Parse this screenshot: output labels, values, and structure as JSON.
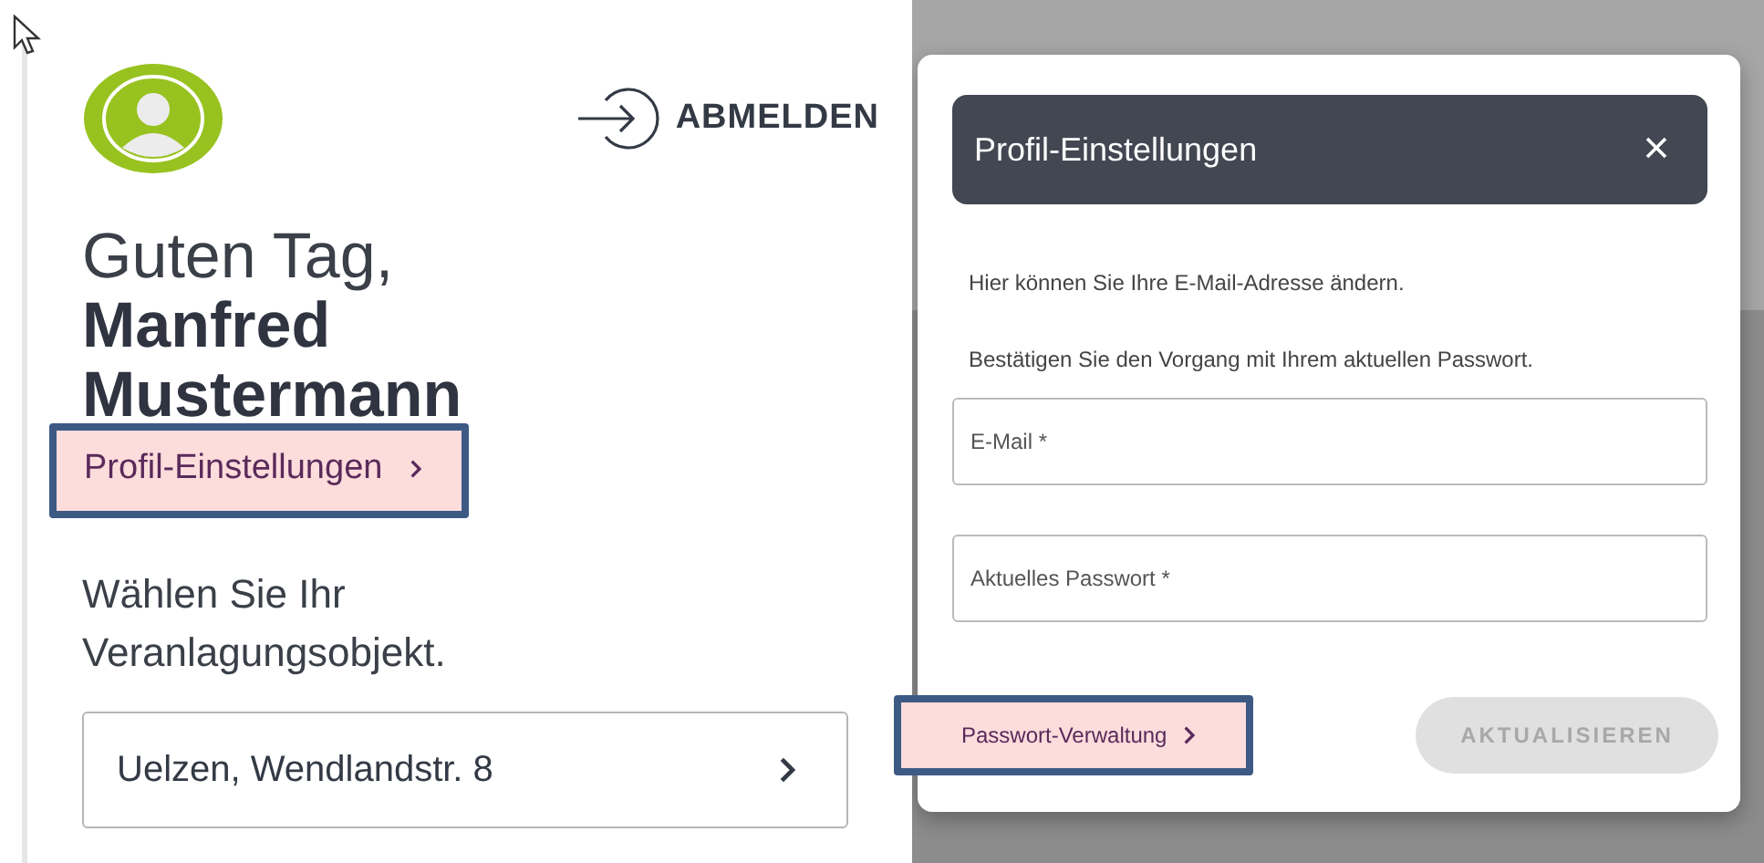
{
  "page": {
    "logout_label": "ABMELDEN",
    "greeting": "Guten Tag,",
    "name": "Manfred Mustermann",
    "profile_link": "Profil-Einstellungen",
    "prompt": "Wählen Sie Ihr Veranlagungsobjekt.",
    "objects": [
      {
        "label": "Uelzen, Wendlandstr. 8"
      }
    ]
  },
  "dialog": {
    "title": "Profil-Einstellungen",
    "texts": [
      "Hier können Sie Ihre E-Mail-Adresse ändern.",
      "Bestätigen Sie den Vorgang mit Ihrem aktuellen Passwort."
    ],
    "fields": [
      {
        "placeholder": "E-Mail *"
      },
      {
        "placeholder": "Aktuelles Passwort *"
      }
    ],
    "link": "Passwort-Verwaltung",
    "submit": {
      "label": "AKTUALISIEREN",
      "disabled": true
    }
  }
}
